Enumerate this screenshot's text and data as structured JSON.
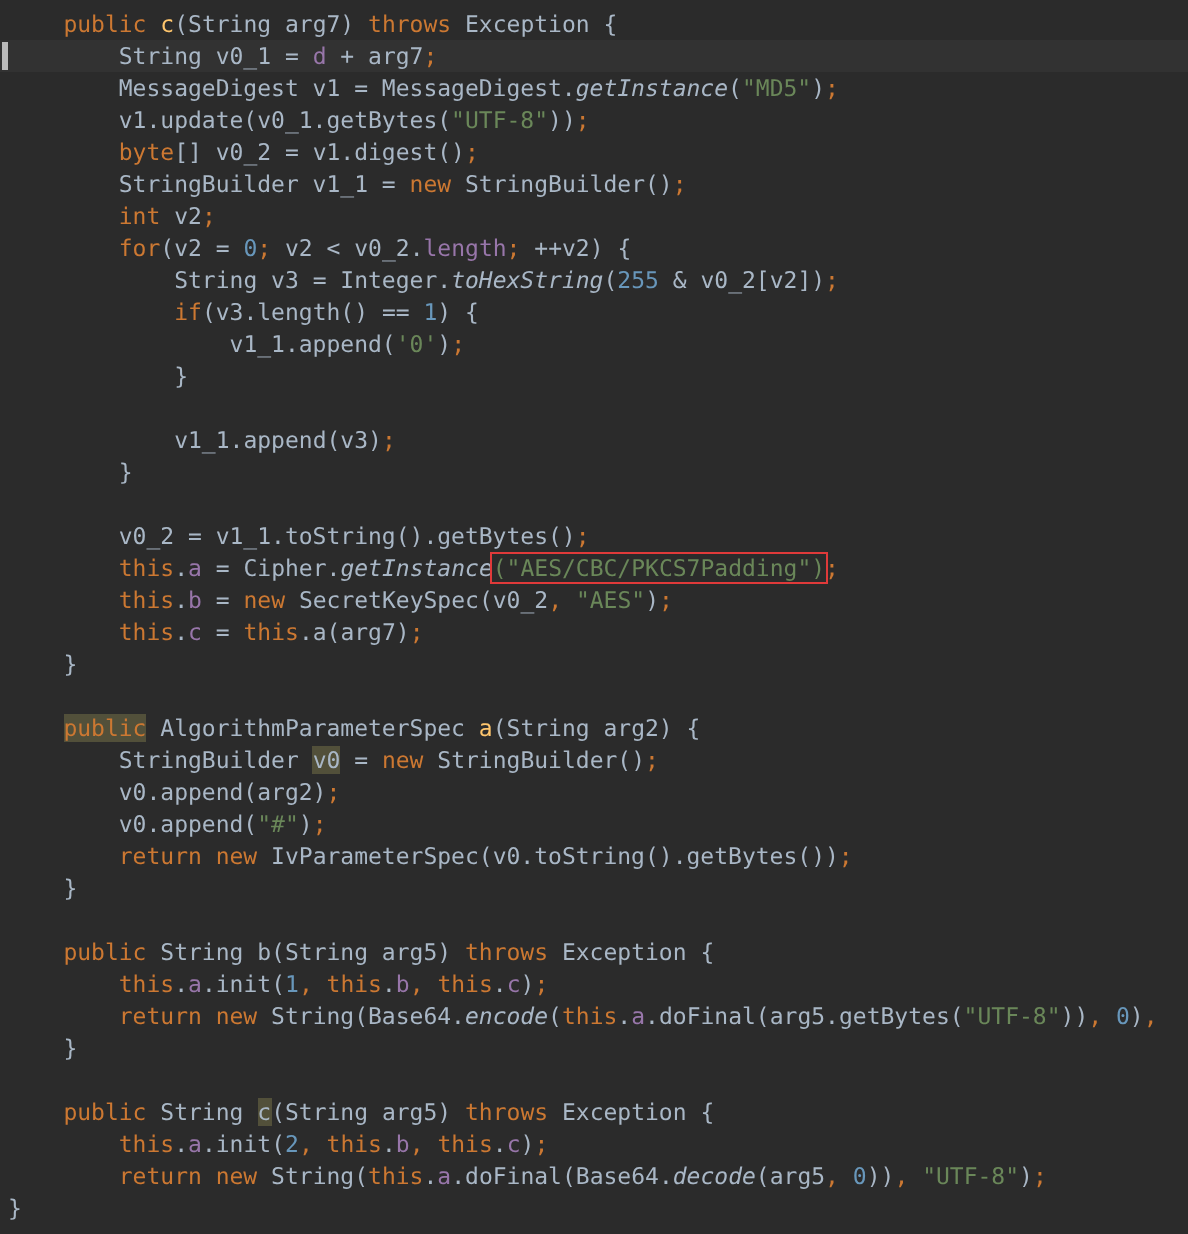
{
  "editor": {
    "lines": [
      {
        "children": [
          {
            "current": false,
            "tokens": [
              {
                "text": "public ",
                "kind": "keyword"
              },
              {
                "text": "c",
                "kind": "method"
              },
              {
                "text": "(String arg7) ",
                "kind": "plain"
              },
              {
                "text": "throws",
                "kind": "keyword"
              },
              {
                "text": " Exception {",
                "kind": "plain"
              }
            ],
            "children": [
              {
                "current": true,
                "tokens": [
                  {
                    "text": "String v0_1 = ",
                    "kind": "plain"
                  },
                  {
                    "text": "d",
                    "kind": "field"
                  },
                  {
                    "text": " + arg7",
                    "kind": "plain"
                  },
                  {
                    "text": ";",
                    "kind": "keyword"
                  }
                ]
              },
              {
                "current": false,
                "tokens": [
                  {
                    "text": "MessageDigest v1 = MessageDigest.",
                    "kind": "plain"
                  },
                  {
                    "text": "getInstance",
                    "kind": "static"
                  },
                  {
                    "text": "(",
                    "kind": "plain"
                  },
                  {
                    "text": "\"MD5\"",
                    "kind": "string"
                  },
                  {
                    "text": ")",
                    "kind": "plain"
                  },
                  {
                    "text": ";",
                    "kind": "keyword"
                  }
                ]
              },
              {
                "current": false,
                "tokens": [
                  {
                    "text": "v1.update(v0_1.getBytes(",
                    "kind": "plain"
                  },
                  {
                    "text": "\"UTF-8\"",
                    "kind": "string"
                  },
                  {
                    "text": "))",
                    "kind": "plain"
                  },
                  {
                    "text": ";",
                    "kind": "keyword"
                  }
                ]
              },
              {
                "current": false,
                "tokens": [
                  {
                    "text": "byte",
                    "kind": "keyword"
                  },
                  {
                    "text": "[] v0_2 = v1.digest()",
                    "kind": "plain"
                  },
                  {
                    "text": ";",
                    "kind": "keyword"
                  }
                ]
              },
              {
                "current": false,
                "tokens": [
                  {
                    "text": "StringBuilder v1_1 = ",
                    "kind": "plain"
                  },
                  {
                    "text": "new",
                    "kind": "keyword"
                  },
                  {
                    "text": " StringBuilder()",
                    "kind": "plain"
                  },
                  {
                    "text": ";",
                    "kind": "keyword"
                  }
                ]
              },
              {
                "current": false,
                "tokens": [
                  {
                    "text": "int",
                    "kind": "keyword"
                  },
                  {
                    "text": " v2",
                    "kind": "plain"
                  },
                  {
                    "text": ";",
                    "kind": "keyword"
                  }
                ]
              },
              {
                "current": false,
                "tokens": [
                  {
                    "text": "for",
                    "kind": "keyword"
                  },
                  {
                    "text": "(v2 = ",
                    "kind": "plain"
                  },
                  {
                    "text": "0",
                    "kind": "number"
                  },
                  {
                    "text": ";",
                    "kind": "keyword"
                  },
                  {
                    "text": " v2 < v0_2.",
                    "kind": "plain"
                  },
                  {
                    "text": "length",
                    "kind": "field"
                  },
                  {
                    "text": ";",
                    "kind": "keyword"
                  },
                  {
                    "text": " ++v2) {",
                    "kind": "plain"
                  }
                ],
                "children": [
                  {
                    "current": false,
                    "tokens": [
                      {
                        "text": "String v3 = Integer.",
                        "kind": "plain"
                      },
                      {
                        "text": "toHexString",
                        "kind": "static"
                      },
                      {
                        "text": "(",
                        "kind": "plain"
                      },
                      {
                        "text": "255",
                        "kind": "number"
                      },
                      {
                        "text": " & v0_2[v2])",
                        "kind": "plain"
                      },
                      {
                        "text": ";",
                        "kind": "keyword"
                      }
                    ]
                  },
                  {
                    "current": false,
                    "tokens": [
                      {
                        "text": "if",
                        "kind": "keyword"
                      },
                      {
                        "text": "(v3.length() == ",
                        "kind": "plain"
                      },
                      {
                        "text": "1",
                        "kind": "number"
                      },
                      {
                        "text": ") {",
                        "kind": "plain"
                      }
                    ],
                    "children": [
                      {
                        "current": false,
                        "tokens": [
                          {
                            "text": "v1_1.append(",
                            "kind": "plain"
                          },
                          {
                            "text": "'0'",
                            "kind": "string"
                          },
                          {
                            "text": ")",
                            "kind": "plain"
                          },
                          {
                            "text": ";",
                            "kind": "keyword"
                          }
                        ]
                      }
                    ]
                  },
                  {
                    "current": false,
                    "tokens": [
                      {
                        "text": "}",
                        "kind": "plain"
                      }
                    ]
                  },
                  {
                    "current": false
                  },
                  {
                    "current": false,
                    "tokens": [
                      {
                        "text": "v1_1.append(v3)",
                        "kind": "plain"
                      },
                      {
                        "text": ";",
                        "kind": "keyword"
                      }
                    ]
                  }
                ]
              },
              {
                "current": false,
                "tokens": [
                  {
                    "text": "}",
                    "kind": "plain"
                  }
                ]
              },
              {
                "current": false
              },
              {
                "current": false,
                "tokens": [
                  {
                    "text": "v0_2 = v1_1.toString().getBytes()",
                    "kind": "plain"
                  },
                  {
                    "text": ";",
                    "kind": "keyword"
                  }
                ]
              },
              {
                "current": false,
                "tokens": [
                  {
                    "text": "this",
                    "kind": "keyword"
                  },
                  {
                    "text": ".",
                    "kind": "plain"
                  },
                  {
                    "text": "a",
                    "kind": "field"
                  },
                  {
                    "text": " = Cipher.",
                    "kind": "plain"
                  },
                  {
                    "text": "getInstance",
                    "kind": "static"
                  },
                  {
                    "text": "(\"AES/CBC/PKCS7Padding\")",
                    "kind": "string",
                    "boxed": true
                  },
                  {
                    "text": ";",
                    "kind": "keyword"
                  }
                ]
              },
              {
                "current": false,
                "tokens": [
                  {
                    "text": "this",
                    "kind": "keyword"
                  },
                  {
                    "text": ".",
                    "kind": "plain"
                  },
                  {
                    "text": "b",
                    "kind": "field"
                  },
                  {
                    "text": " = ",
                    "kind": "plain"
                  },
                  {
                    "text": "new",
                    "kind": "keyword"
                  },
                  {
                    "text": " SecretKeySpec(v0_2",
                    "kind": "plain"
                  },
                  {
                    "text": ", ",
                    "kind": "keyword"
                  },
                  {
                    "text": "\"AES\"",
                    "kind": "string"
                  },
                  {
                    "text": ")",
                    "kind": "plain"
                  },
                  {
                    "text": ";",
                    "kind": "keyword"
                  }
                ]
              },
              {
                "current": false,
                "tokens": [
                  {
                    "text": "this",
                    "kind": "keyword"
                  },
                  {
                    "text": ".",
                    "kind": "plain"
                  },
                  {
                    "text": "c",
                    "kind": "field"
                  },
                  {
                    "text": " = ",
                    "kind": "plain"
                  },
                  {
                    "text": "this",
                    "kind": "keyword"
                  },
                  {
                    "text": ".a(arg7)",
                    "kind": "plain"
                  },
                  {
                    "text": ";",
                    "kind": "keyword"
                  }
                ]
              }
            ]
          },
          {
            "current": false,
            "tokens": [
              {
                "text": "}",
                "kind": "plain"
              }
            ]
          },
          {
            "current": false
          },
          {
            "current": false,
            "tokens": [
              {
                "text": "public",
                "kind": "keyword",
                "marked": true
              },
              {
                "text": " AlgorithmParameterSpec ",
                "kind": "plain"
              },
              {
                "text": "a",
                "kind": "method"
              },
              {
                "text": "(String arg2) {",
                "kind": "plain"
              }
            ],
            "children": [
              {
                "current": false,
                "tokens": [
                  {
                    "text": "StringBuilder ",
                    "kind": "plain"
                  },
                  {
                    "text": "v0",
                    "kind": "plain",
                    "marked": true
                  },
                  {
                    "text": " = ",
                    "kind": "plain"
                  },
                  {
                    "text": "new",
                    "kind": "keyword"
                  },
                  {
                    "text": " StringBuilder()",
                    "kind": "plain"
                  },
                  {
                    "text": ";",
                    "kind": "keyword"
                  }
                ]
              },
              {
                "current": false,
                "tokens": [
                  {
                    "text": "v0.append(arg2)",
                    "kind": "plain"
                  },
                  {
                    "text": ";",
                    "kind": "keyword"
                  }
                ]
              },
              {
                "current": false,
                "tokens": [
                  {
                    "text": "v0.append(",
                    "kind": "plain"
                  },
                  {
                    "text": "\"#\"",
                    "kind": "string"
                  },
                  {
                    "text": ")",
                    "kind": "plain"
                  },
                  {
                    "text": ";",
                    "kind": "keyword"
                  }
                ]
              },
              {
                "current": false,
                "tokens": [
                  {
                    "text": "return new",
                    "kind": "keyword"
                  },
                  {
                    "text": " IvParameterSpec(v0.toString().getBytes())",
                    "kind": "plain"
                  },
                  {
                    "text": ";",
                    "kind": "keyword"
                  }
                ]
              }
            ]
          },
          {
            "current": false,
            "tokens": [
              {
                "text": "}",
                "kind": "plain"
              }
            ]
          },
          {
            "current": false
          },
          {
            "current": false,
            "tokens": [
              {
                "text": "public",
                "kind": "keyword"
              },
              {
                "text": " String b(String arg5) ",
                "kind": "plain"
              },
              {
                "text": "throws",
                "kind": "keyword"
              },
              {
                "text": " Exception {",
                "kind": "plain"
              }
            ],
            "children": [
              {
                "current": false,
                "tokens": [
                  {
                    "text": "this",
                    "kind": "keyword"
                  },
                  {
                    "text": ".",
                    "kind": "plain"
                  },
                  {
                    "text": "a",
                    "kind": "field"
                  },
                  {
                    "text": ".init(",
                    "kind": "plain"
                  },
                  {
                    "text": "1",
                    "kind": "number"
                  },
                  {
                    "text": ", this",
                    "kind": "keyword"
                  },
                  {
                    "text": ".",
                    "kind": "plain"
                  },
                  {
                    "text": "b",
                    "kind": "field"
                  },
                  {
                    "text": ", this",
                    "kind": "keyword"
                  },
                  {
                    "text": ".",
                    "kind": "plain"
                  },
                  {
                    "text": "c",
                    "kind": "field"
                  },
                  {
                    "text": ")",
                    "kind": "plain"
                  },
                  {
                    "text": ";",
                    "kind": "keyword"
                  }
                ]
              },
              {
                "current": false,
                "tokens": [
                  {
                    "text": "return new",
                    "kind": "keyword"
                  },
                  {
                    "text": " String(Base64.",
                    "kind": "plain"
                  },
                  {
                    "text": "encode",
                    "kind": "static"
                  },
                  {
                    "text": "(",
                    "kind": "plain"
                  },
                  {
                    "text": "this",
                    "kind": "keyword"
                  },
                  {
                    "text": ".",
                    "kind": "plain"
                  },
                  {
                    "text": "a",
                    "kind": "field"
                  },
                  {
                    "text": ".doFinal(arg5.getBytes(",
                    "kind": "plain"
                  },
                  {
                    "text": "\"UTF-8\"",
                    "kind": "string"
                  },
                  {
                    "text": "))",
                    "kind": "plain"
                  },
                  {
                    "text": ", ",
                    "kind": "keyword"
                  },
                  {
                    "text": "0",
                    "kind": "number"
                  },
                  {
                    "text": ")",
                    "kind": "plain"
                  },
                  {
                    "text": ",",
                    "kind": "keyword"
                  }
                ]
              }
            ]
          },
          {
            "current": false,
            "tokens": [
              {
                "text": "}",
                "kind": "plain"
              }
            ]
          },
          {
            "current": false
          },
          {
            "current": false,
            "tokens": [
              {
                "text": "public",
                "kind": "keyword"
              },
              {
                "text": " String ",
                "kind": "plain"
              },
              {
                "text": "c",
                "kind": "plain",
                "marked": true
              },
              {
                "text": "(String arg5) ",
                "kind": "plain"
              },
              {
                "text": "throws",
                "kind": "keyword"
              },
              {
                "text": " Exception {",
                "kind": "plain"
              }
            ],
            "children": [
              {
                "current": false,
                "tokens": [
                  {
                    "text": "this",
                    "kind": "keyword"
                  },
                  {
                    "text": ".",
                    "kind": "plain"
                  },
                  {
                    "text": "a",
                    "kind": "field"
                  },
                  {
                    "text": ".init(",
                    "kind": "plain"
                  },
                  {
                    "text": "2",
                    "kind": "number"
                  },
                  {
                    "text": ", this",
                    "kind": "keyword"
                  },
                  {
                    "text": ".",
                    "kind": "plain"
                  },
                  {
                    "text": "b",
                    "kind": "field"
                  },
                  {
                    "text": ", this",
                    "kind": "keyword"
                  },
                  {
                    "text": ".",
                    "kind": "plain"
                  },
                  {
                    "text": "c",
                    "kind": "field"
                  },
                  {
                    "text": ")",
                    "kind": "plain"
                  },
                  {
                    "text": ";",
                    "kind": "keyword"
                  }
                ]
              },
              {
                "current": false,
                "tokens": [
                  {
                    "text": "return new",
                    "kind": "keyword"
                  },
                  {
                    "text": " String(",
                    "kind": "plain"
                  },
                  {
                    "text": "this",
                    "kind": "keyword"
                  },
                  {
                    "text": ".",
                    "kind": "plain"
                  },
                  {
                    "text": "a",
                    "kind": "field"
                  },
                  {
                    "text": ".doFinal(Base64.",
                    "kind": "plain"
                  },
                  {
                    "text": "decode",
                    "kind": "static"
                  },
                  {
                    "text": "(arg5",
                    "kind": "plain"
                  },
                  {
                    "text": ", ",
                    "kind": "keyword"
                  },
                  {
                    "text": "0",
                    "kind": "number"
                  },
                  {
                    "text": "))",
                    "kind": "plain"
                  },
                  {
                    "text": ", ",
                    "kind": "keyword"
                  },
                  {
                    "text": "\"UTF-8\"",
                    "kind": "string"
                  },
                  {
                    "text": ")",
                    "kind": "plain"
                  },
                  {
                    "text": ";",
                    "kind": "keyword"
                  }
                ]
              }
            ]
          }
        ]
      },
      {
        "current": false,
        "tokens": [
          {
            "text": "}",
            "kind": "plain"
          }
        ]
      }
    ]
  }
}
